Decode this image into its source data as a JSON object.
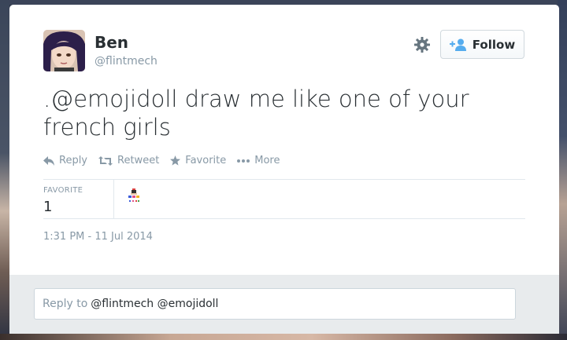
{
  "tweet": {
    "author_name": "Ben",
    "author_handle": "@flintmech",
    "text": ".@emojidoll draw me like one of your french girls",
    "timestamp": "1:31 PM - 11 Jul 2014"
  },
  "header": {
    "follow_label": "Follow"
  },
  "actions": {
    "reply": "Reply",
    "retweet": "Retweet",
    "favorite": "Favorite",
    "more": "More"
  },
  "stats": {
    "favorite_label": "FAVORITE",
    "favorite_count": "1"
  },
  "reply": {
    "placeholder": "Reply to",
    "prefill": "@flintmech @emojidoll"
  },
  "colors": {
    "text": "#292f33",
    "muted": "#8899a6",
    "follow_icon": "#55acee"
  }
}
